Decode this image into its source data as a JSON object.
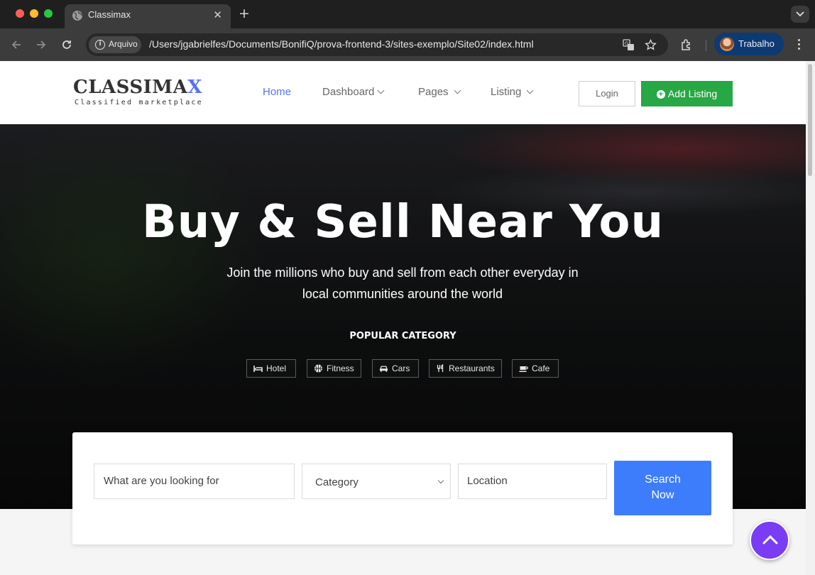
{
  "browser": {
    "tab_title": "Classimax",
    "security_label": "Arquivo",
    "url": "/Users/jgabrielfes/Documents/BonifiQ/prova-frontend-3/sites-exemplo/Site02/index.html",
    "profile_name": "Trabalho"
  },
  "site": {
    "logo": {
      "main": "CLASSIMA",
      "accent": "X",
      "tagline": "Classified marketplace"
    },
    "nav": [
      {
        "label": "Home"
      },
      {
        "label": "Dashboard"
      },
      {
        "label": "Pages"
      },
      {
        "label": "Listing"
      }
    ],
    "login_label": "Login",
    "add_listing_label": "Add Listing",
    "accent_color": "#5672f9"
  },
  "hero": {
    "title": "Buy & Sell Near You",
    "subtitle": "Join the millions who buy and sell from each other everyday in local communities around the world",
    "popular_heading": "POPULAR CATEGORY",
    "categories": [
      {
        "label": "Hotel",
        "icon": "bed-icon"
      },
      {
        "label": "Fitness",
        "icon": "basketball-icon"
      },
      {
        "label": "Cars",
        "icon": "car-icon"
      },
      {
        "label": "Restaurants",
        "icon": "cutlery-icon"
      },
      {
        "label": "Cafe",
        "icon": "coffee-icon"
      }
    ]
  },
  "search": {
    "keyword_placeholder": "What are you looking for",
    "category_selected": "Category",
    "location_placeholder": "Location",
    "button_label": "Search Now"
  }
}
